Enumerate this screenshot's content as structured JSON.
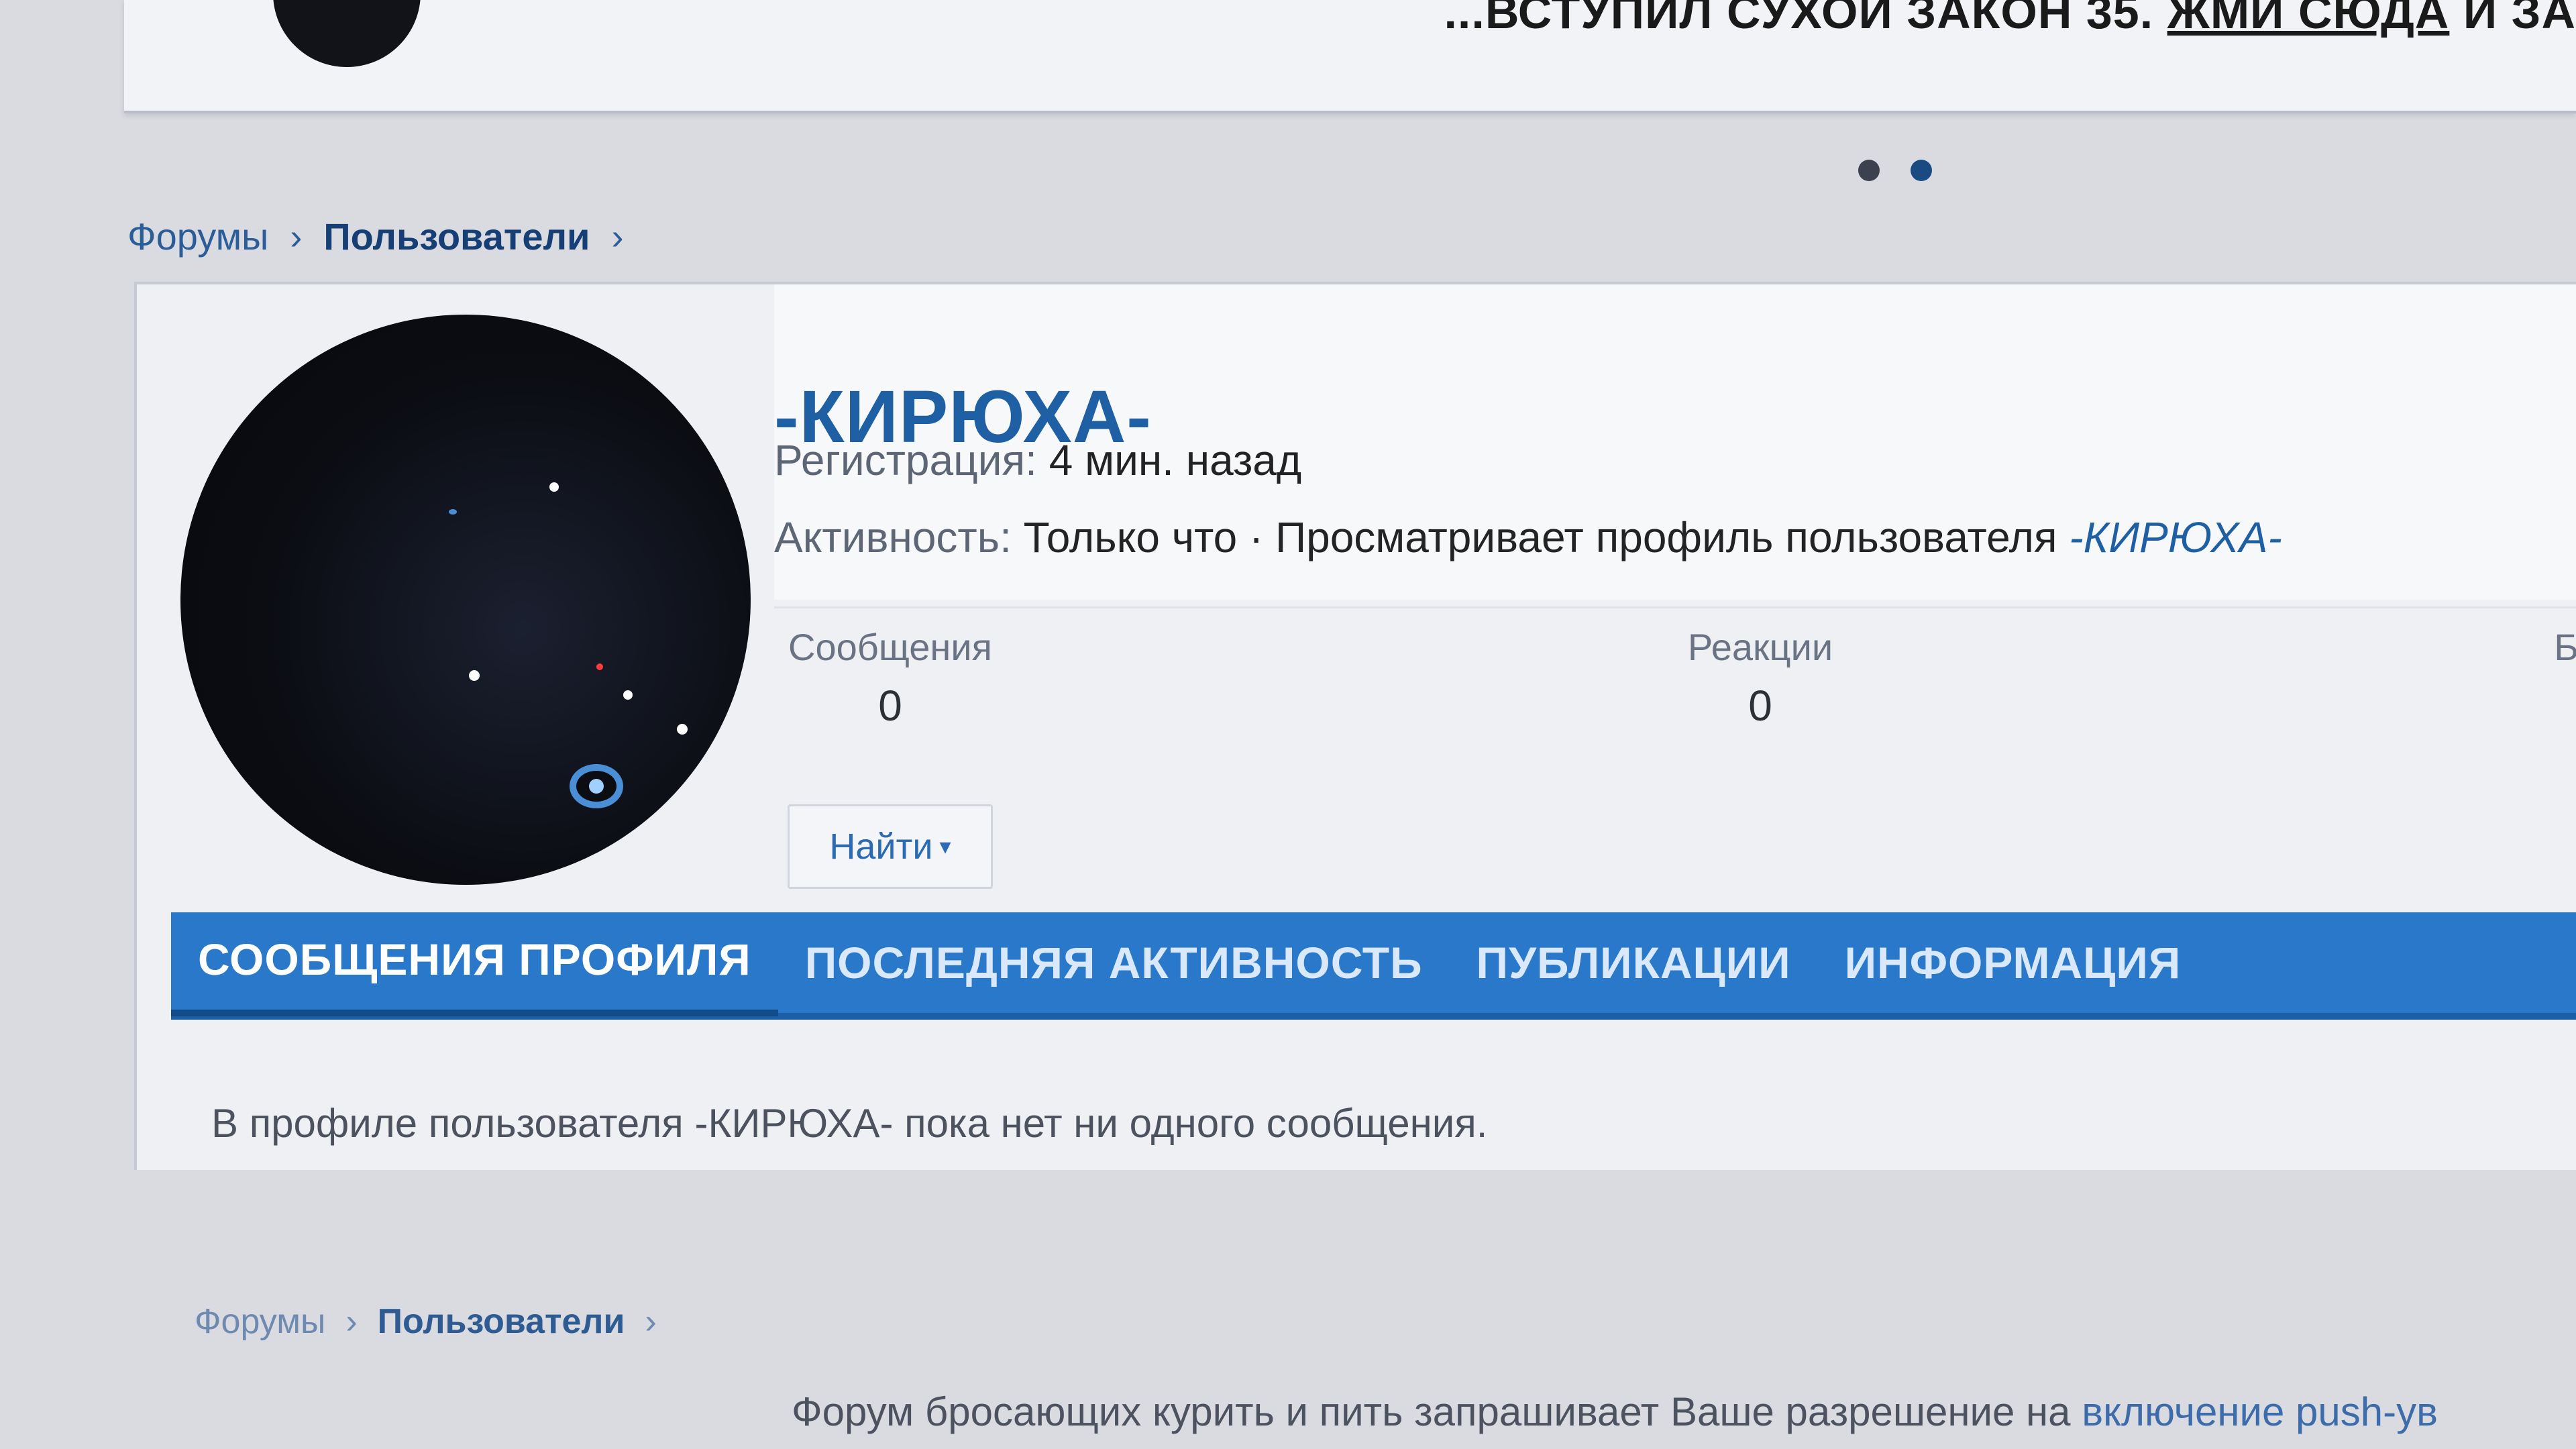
{
  "banner": {
    "text": "...ВСТУПИЛ СУХОЙ ЗАКОН 35.",
    "link": "ЖМИ СЮДА",
    "tail": "И ЗА"
  },
  "breadcrumb": {
    "forums": "Форумы",
    "users": "Пользователи",
    "separator": "›"
  },
  "profile": {
    "username": "-КИРЮХА-",
    "registration_label": "Регистрация:",
    "registration_value": "4 мин. назад",
    "activity_label": "Активность:",
    "activity_value": "Только что · Просматривает профиль пользователя",
    "activity_user": "-КИРЮХА-"
  },
  "stats": {
    "messages_label": "Сообщения",
    "messages_value": "0",
    "reactions_label": "Реакции",
    "reactions_value": "0",
    "cut_label": "Б"
  },
  "find_button": {
    "label": "Найти",
    "caret": "▾"
  },
  "tabs": [
    {
      "label": "Сообщения профиля",
      "active": true
    },
    {
      "label": "Последняя активность",
      "active": false
    },
    {
      "label": "Публикации",
      "active": false
    },
    {
      "label": "Информация",
      "active": false
    }
  ],
  "empty_message": "В профиле пользователя -КИРЮХА- пока нет ни одного сообщения.",
  "push_notice": {
    "text": "Форум бросающих курить и пить запрашивает Ваше разрешение на",
    "link": "включение push-ув"
  },
  "colors": {
    "accent": "#2a78c9",
    "link": "#1f5fa3"
  },
  "icons": {
    "dropdown": "chevron-down-icon"
  }
}
